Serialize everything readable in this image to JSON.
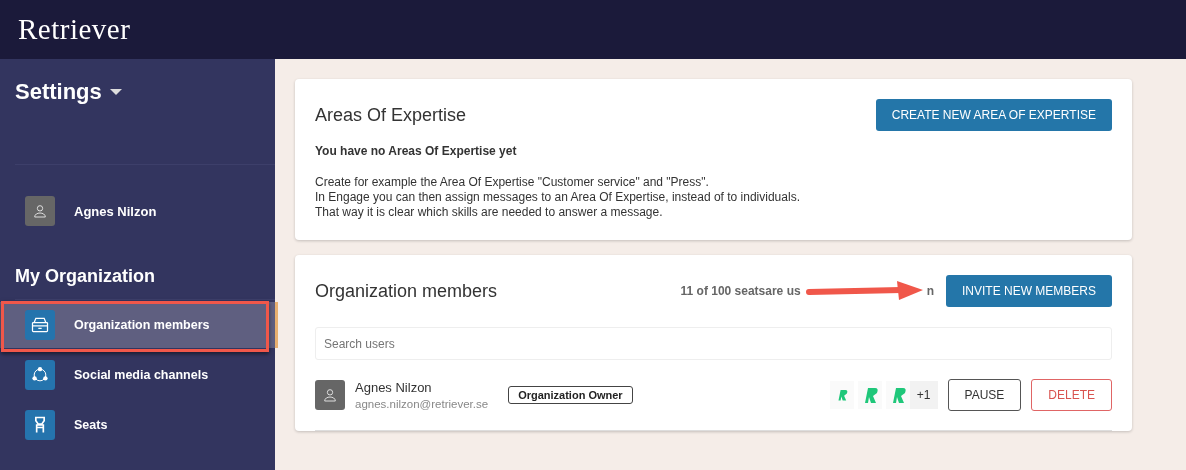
{
  "header": {
    "logo": "Retriever"
  },
  "sidebar": {
    "title": "Settings",
    "user": {
      "name": "Agnes Nilzon"
    },
    "section": "My Organization",
    "items": [
      {
        "label": "Organization members",
        "kind": "members",
        "selected": true,
        "highlighted": true
      },
      {
        "label": "Social media channels",
        "kind": "channels",
        "selected": false,
        "highlighted": false
      },
      {
        "label": "Seats",
        "kind": "seats",
        "selected": false,
        "highlighted": false
      }
    ]
  },
  "expertise": {
    "title": "Areas Of Expertise",
    "button": "CREATE NEW AREA OF EXPERTISE",
    "empty": "You have no Areas Of Expertise yet",
    "lines": [
      "Create for example the Area Of Expertise \"Customer service\" and \"Press\".",
      "In Engage you can then assign messages to an Area Of Expertise, instead of to individuals.",
      "That way it is clear which skills are needed to answer a message."
    ]
  },
  "members": {
    "title": "Organization members",
    "seats_text": "11 of 100 seatsare us",
    "seats_text_end": "n",
    "button": "INVITE NEW MEMBERS",
    "search": {
      "placeholder": "Search users"
    },
    "rows": [
      {
        "name": "Agnes Nilzon",
        "email": "agnes.nilzon@retriever.se",
        "role": "Organization Owner",
        "extra": "+1",
        "pause": "PAUSE",
        "delete": "DELETE"
      }
    ]
  }
}
